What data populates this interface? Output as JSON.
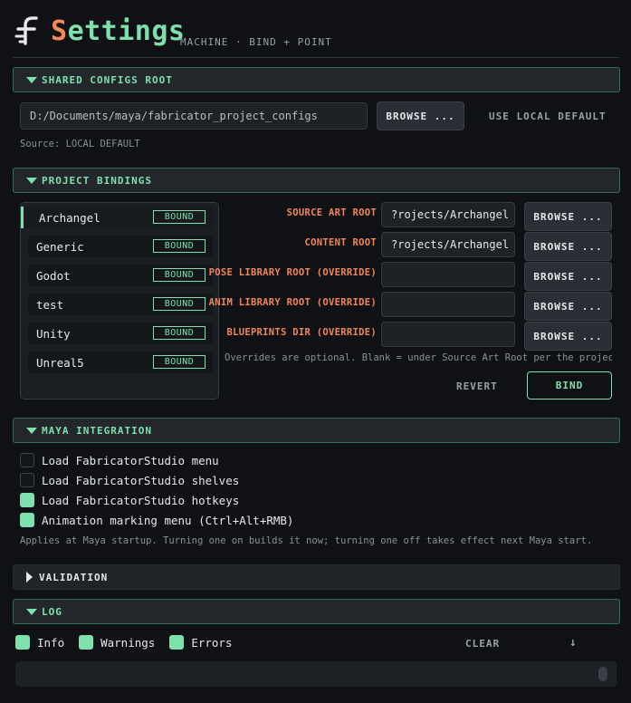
{
  "header": {
    "title_s": "S",
    "title_rest": "ettings",
    "subtitle": "MACHINE · BIND + POINT",
    "logo_icon": "fabricator-logo-icon"
  },
  "shared_configs": {
    "title": "SHARED CONFIGS ROOT",
    "path_value": "D:/Documents/maya/fabricator_project_configs",
    "browse_label": "BROWSE ...",
    "default_label": "USE LOCAL DEFAULT",
    "source_text": "Source: LOCAL DEFAULT"
  },
  "project_bindings": {
    "title": "PROJECT BINDINGS",
    "projects": [
      {
        "name": "Archangel",
        "status": "BOUND"
      },
      {
        "name": "Generic",
        "status": "BOUND"
      },
      {
        "name": "Godot",
        "status": "BOUND"
      },
      {
        "name": "test",
        "status": "BOUND"
      },
      {
        "name": "Unity",
        "status": "BOUND"
      },
      {
        "name": "Unreal5",
        "status": "BOUND"
      }
    ],
    "fields": [
      {
        "label": "SOURCE ART ROOT",
        "value": "?rojects/Archangel",
        "browse": "BROWSE ..."
      },
      {
        "label": "CONTENT ROOT",
        "value": "?rojects/Archangel",
        "browse": "BROWSE ..."
      },
      {
        "label": "POSE LIBRARY ROOT (OVERRIDE)",
        "value": "",
        "browse": "BROWSE ..."
      },
      {
        "label": "ANIM LIBRARY ROOT (OVERRIDE)",
        "value": "",
        "browse": "BROWSE ..."
      },
      {
        "label": "BLUEPRINTS DIR (OVERRIDE)",
        "value": "",
        "browse": "BROWSE ..."
      }
    ],
    "note": "Overrides are optional. Blank = under Source Art Root per the project's",
    "revert_label": "REVERT",
    "bind_label": "BIND"
  },
  "maya_integration": {
    "title": "MAYA INTEGRATION",
    "options": [
      {
        "label": "Load FabricatorStudio menu",
        "checked": false
      },
      {
        "label": "Load FabricatorStudio shelves",
        "checked": false
      },
      {
        "label": "Load FabricatorStudio hotkeys",
        "checked": true
      },
      {
        "label": "Animation marking menu (Ctrl+Alt+RMB)",
        "checked": true
      }
    ],
    "note": "Applies at Maya startup. Turning one on builds it now; turning one off takes effect next Maya start."
  },
  "validation": {
    "title": "VALIDATION"
  },
  "log": {
    "title": "LOG",
    "filters": [
      {
        "label": "Info",
        "checked": true
      },
      {
        "label": "Warnings",
        "checked": true
      },
      {
        "label": "Errors",
        "checked": true
      }
    ],
    "clear_label": "CLEAR",
    "scroll_glyph": "↓"
  },
  "colors": {
    "accent": "#7ee0ac",
    "warning_label": "#f0865a",
    "background": "#0f1114"
  }
}
